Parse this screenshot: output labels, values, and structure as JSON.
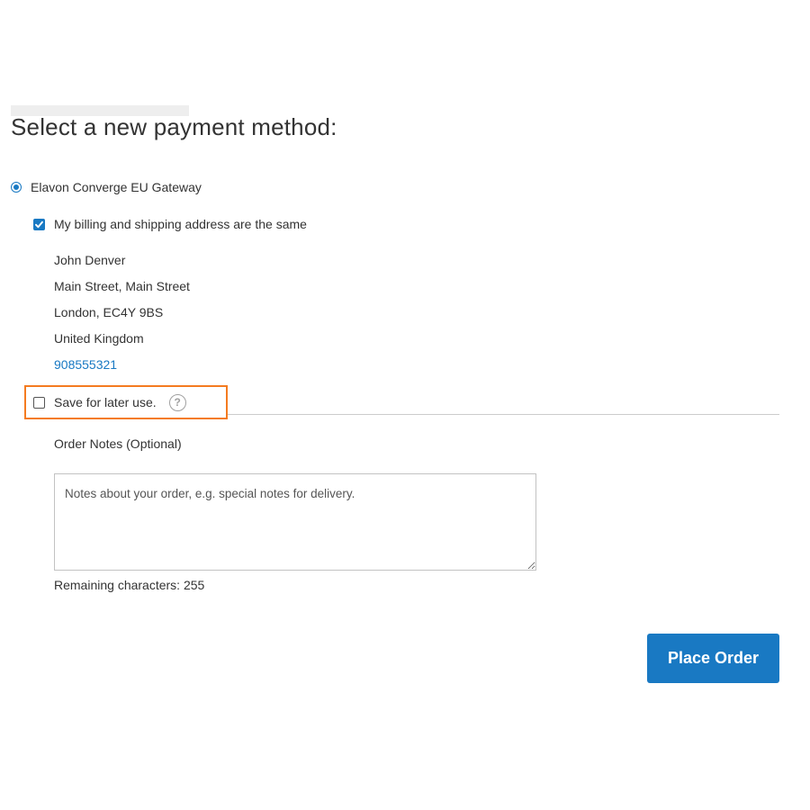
{
  "heading": "Select a new payment method:",
  "payment_method": {
    "label": "Elavon Converge EU Gateway",
    "selected": true
  },
  "billing_same": {
    "label": "My billing and shipping address are the same",
    "checked": true
  },
  "address": {
    "name": "John Denver",
    "street": "Main Street, Main Street",
    "city": "London, EC4Y 9BS",
    "country": "United Kingdom",
    "phone": "908555321"
  },
  "save_for_later": {
    "label": "Save for later use.",
    "checked": false,
    "help_glyph": "?"
  },
  "order_notes": {
    "label": "Order Notes (Optional)",
    "placeholder": "Notes about your order, e.g. special notes for delivery.",
    "value": "",
    "remaining": "Remaining characters: 255"
  },
  "place_order_label": "Place Order",
  "colors": {
    "accent": "#1979c3",
    "highlight_border": "#f47b20"
  }
}
